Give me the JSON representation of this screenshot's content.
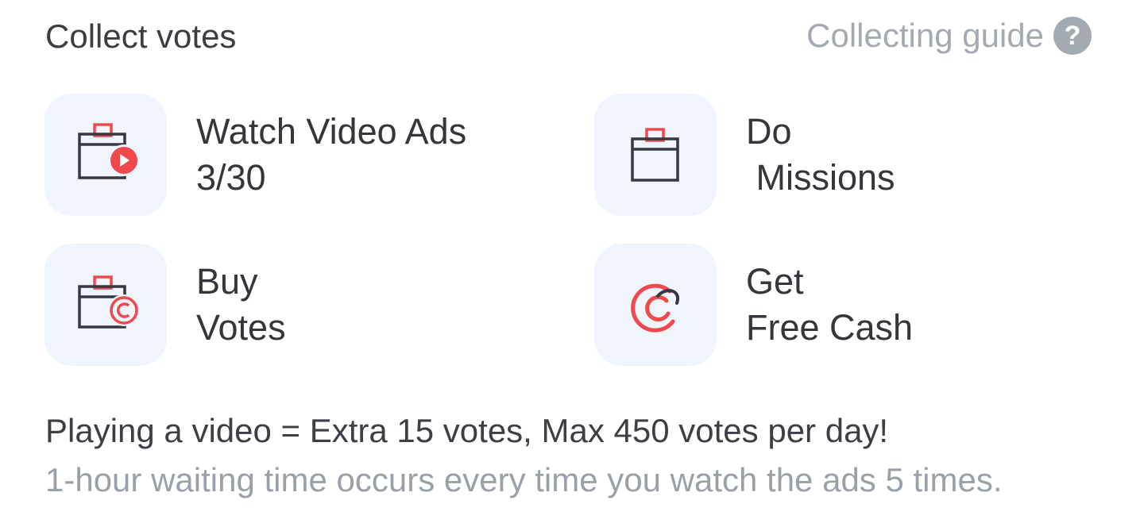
{
  "header": {
    "title": "Collect votes",
    "guide_label": "Collecting guide",
    "guide_icon": "question-circle-icon",
    "guide_icon_glyph": "?"
  },
  "actions": [
    {
      "line1": "Watch Video Ads",
      "line2": "3/30",
      "icon": "ballot-box-play-icon"
    },
    {
      "line1": "Do",
      "line2": " Missions",
      "icon": "ballot-box-icon"
    },
    {
      "line1": "Buy",
      "line2": "Votes",
      "icon": "ballot-box-coin-icon"
    },
    {
      "line1": "Get",
      "line2": "Free Cash",
      "icon": "cash-logo-icon"
    }
  ],
  "notes": {
    "main": "Playing a video = Extra 15 votes, Max 450 votes per day!",
    "sub": "1-hour waiting time occurs every time you watch the ads 5 times."
  },
  "colors": {
    "accent": "#f0484b",
    "tile_background": "#f0f5fd",
    "text_primary": "#33363b",
    "text_muted": "#a4aab2"
  }
}
